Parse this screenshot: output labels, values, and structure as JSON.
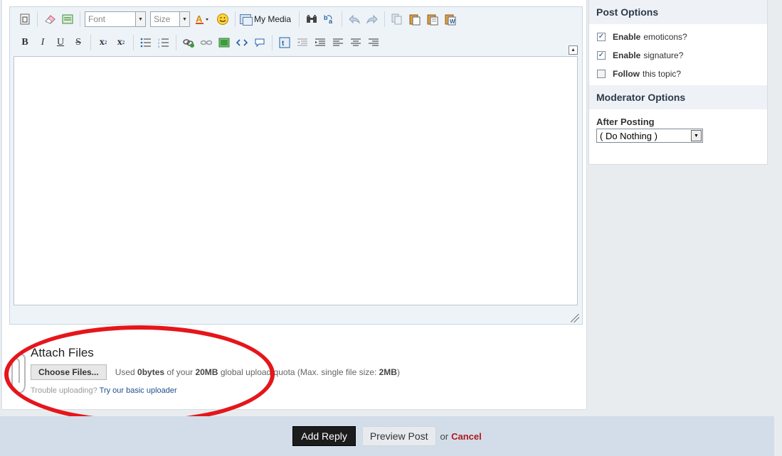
{
  "editor": {
    "font_placeholder": "Font",
    "size_placeholder": "Size",
    "my_media_label": "My Media",
    "toolbar_row1": [
      "source-icon",
      "eraser-icon",
      "special-icon",
      "font-select",
      "size-select",
      "font-color-icon",
      "emoticon-icon",
      "my-media",
      "spell-icon",
      "find-replace-icon",
      "undo-icon",
      "redo-icon",
      "copy-icon",
      "paste-icon",
      "paste-text-icon",
      "paste-word-icon"
    ],
    "toolbar_row2": {
      "bold": "B",
      "italic": "I",
      "underline": "U",
      "strike": "S",
      "subscript": "x",
      "superscript": "x"
    }
  },
  "attach": {
    "title": "Attach Files",
    "choose_label": "Choose Files...",
    "quota_prefix": "Used",
    "quota_used": "0bytes",
    "quota_mid": "of your",
    "quota_total": "20MB",
    "quota_suffix": "global upload quota (Max. single file size:",
    "quota_max": "2MB",
    "quota_close": ")",
    "trouble_text": "Trouble uploading?",
    "trouble_link": "Try our basic uploader"
  },
  "post_options": {
    "title": "Post Options",
    "items": [
      {
        "bold": "Enable",
        "rest": "emoticons?",
        "checked": "✓"
      },
      {
        "bold": "Enable",
        "rest": "signature?",
        "checked": "✓"
      },
      {
        "bold": "Follow",
        "rest": "this topic?",
        "checked": ""
      }
    ]
  },
  "moderator_options": {
    "title": "Moderator Options",
    "after_label": "After Posting",
    "selected": "( Do Nothing )"
  },
  "footer": {
    "add_reply": "Add Reply",
    "preview": "Preview Post",
    "or": "or",
    "cancel": "Cancel"
  },
  "colors": {
    "highlight_ellipse": "#e5161b",
    "footer_bg": "#d2dde9",
    "cancel": "#b01818"
  }
}
